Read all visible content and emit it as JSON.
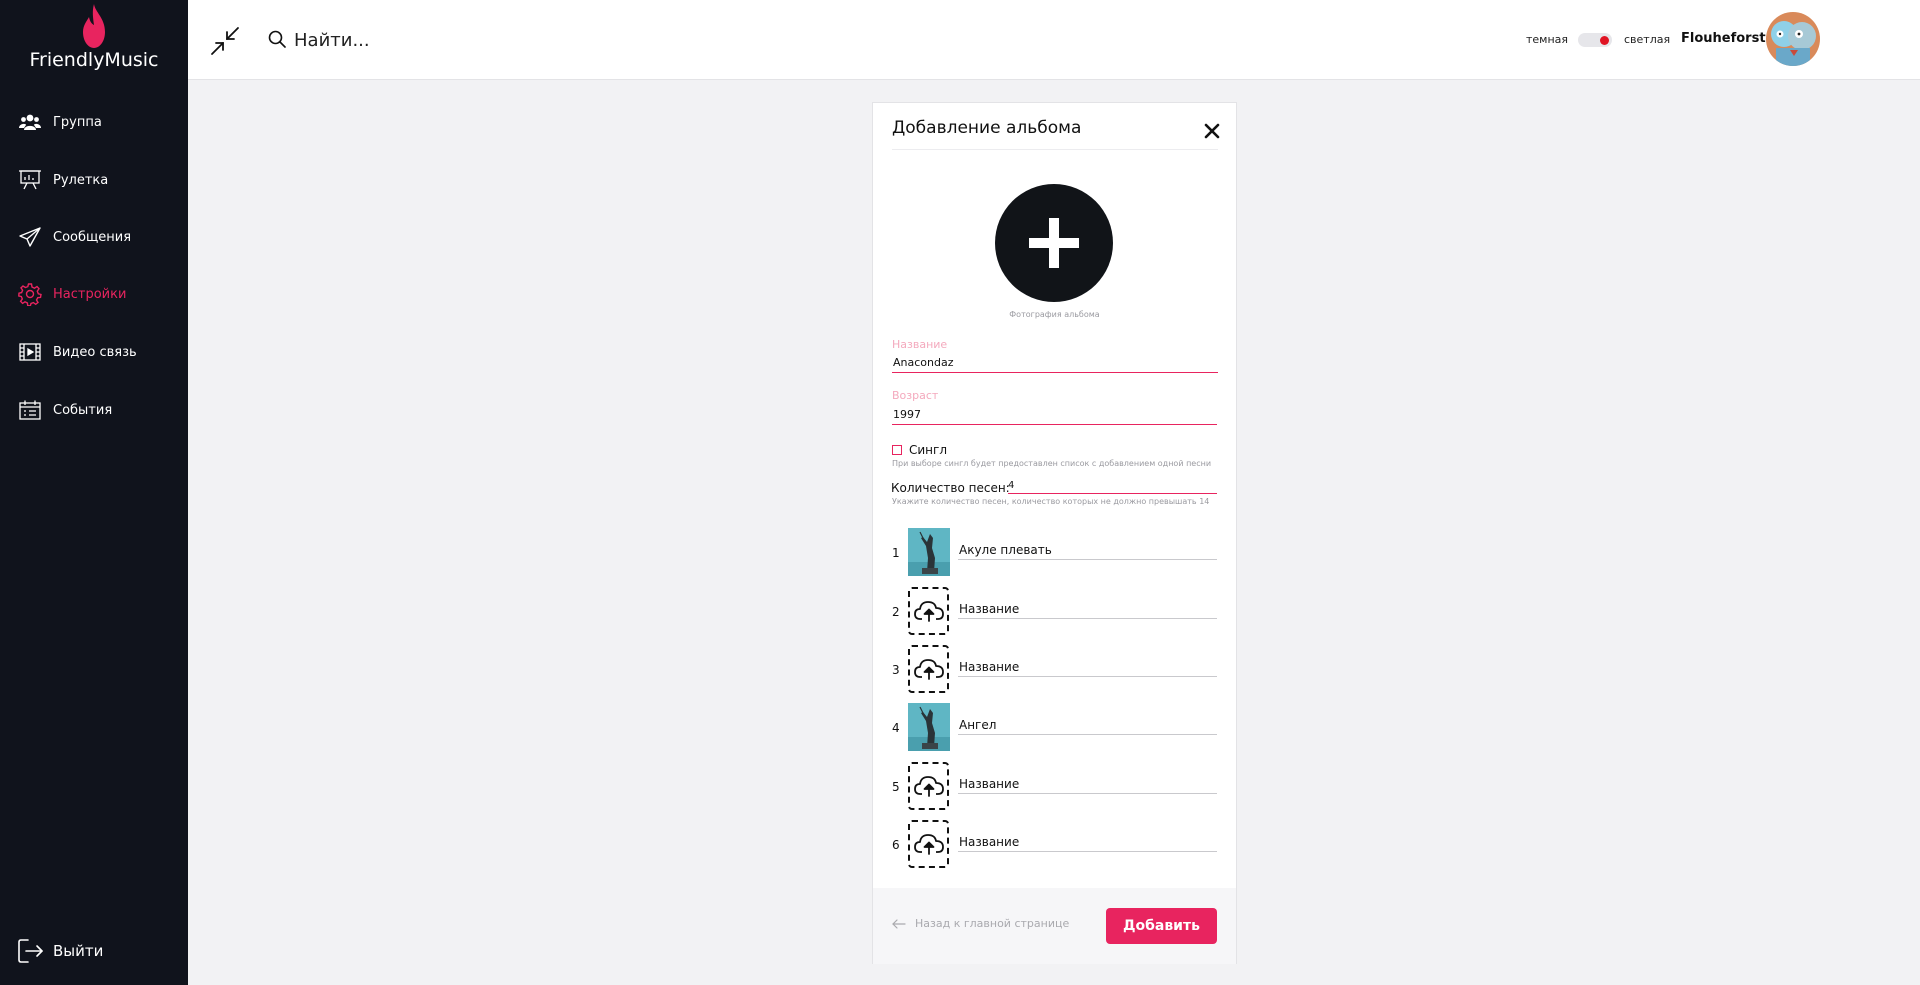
{
  "app": {
    "name": "FriendlyMusic"
  },
  "sidebar": {
    "items": [
      {
        "label": "Группа",
        "icon": "users-icon"
      },
      {
        "label": "Рулетка",
        "icon": "presentation-icon"
      },
      {
        "label": "Сообщения",
        "icon": "paper-plane-icon"
      },
      {
        "label": "Настройки",
        "icon": "gear-icon",
        "active": true
      },
      {
        "label": "Видео связь",
        "icon": "film-icon"
      },
      {
        "label": "События",
        "icon": "calendar-list-icon"
      }
    ],
    "logout_label": "Выйти"
  },
  "header": {
    "search_placeholder": "Найти...",
    "theme_dark_label": "темная",
    "theme_light_label": "светлая",
    "username": "Flouheforst"
  },
  "modal": {
    "title": "Добавление альбома",
    "photo_caption": "Фотография альбома",
    "name_label": "Название",
    "name_value": "Anacondaz",
    "age_label": "Возраст",
    "age_value": "1997",
    "single_label": "Сингл",
    "single_checked": false,
    "single_hint": "При выборе сингл будет предоставлен список с добавлением одной песни",
    "count_label": "Количество песен:",
    "count_value": "4",
    "count_hint": "Укажите количество песен, количество которых не должно превышать 14",
    "song_placeholder": "Название",
    "songs": [
      {
        "num": "1",
        "title": "Акуле плевать",
        "has_cover": true
      },
      {
        "num": "2",
        "title": "",
        "has_cover": false
      },
      {
        "num": "3",
        "title": "",
        "has_cover": false
      },
      {
        "num": "4",
        "title": "Ангел",
        "has_cover": true
      },
      {
        "num": "5",
        "title": "",
        "has_cover": false
      },
      {
        "num": "6",
        "title": "",
        "has_cover": false
      }
    ],
    "back_label": "Назад к главной странице",
    "submit_label": "Добавить"
  },
  "colors": {
    "accent": "#e8245f",
    "sidebar_bg": "#10131c",
    "toggle_knob": "#e01524",
    "label_pink": "#f4a9bd"
  }
}
